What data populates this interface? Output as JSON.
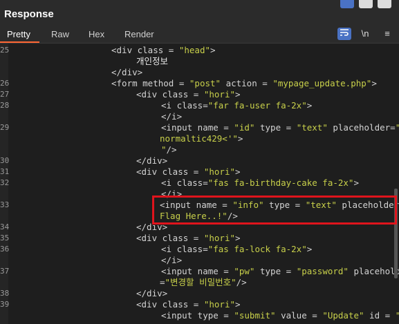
{
  "panel": {
    "title": "Response",
    "tabs": [
      "Pretty",
      "Raw",
      "Hex",
      "Render"
    ],
    "active_tab": "Pretty",
    "tools": {
      "wrap_icon": "wrap-icon",
      "newline_label": "\\n",
      "menu_icon": "hamburger-menu-icon"
    },
    "layout_buttons": [
      "split-horizontal-icon",
      "split-vertical-icon",
      "single-pane-icon"
    ]
  },
  "colors": {
    "accent": "#ff6633",
    "string": "#c8d04a",
    "highlight_border": "#e0141c",
    "active_tool": "#4a72c4"
  },
  "lines": [
    {
      "num": "25",
      "parts": [
        [
          "tag",
          "<div class = "
        ],
        [
          "str",
          "\"head\""
        ],
        [
          "tag",
          ">"
        ]
      ]
    },
    {
      "num": "",
      "parts": [
        [
          "text",
          "개인정보"
        ]
      ]
    },
    {
      "num": "",
      "parts": [
        [
          "tag",
          "</div>"
        ]
      ]
    },
    {
      "num": "26",
      "parts": [
        [
          "tag",
          "<form method = "
        ],
        [
          "str",
          "\"post\""
        ],
        [
          "tag",
          " action = "
        ],
        [
          "str",
          "\"mypage_update.php\""
        ],
        [
          "tag",
          ">"
        ]
      ]
    },
    {
      "num": "27",
      "parts": [
        [
          "tag",
          "<div class = "
        ],
        [
          "str",
          "\"hori\""
        ],
        [
          "tag",
          ">"
        ]
      ]
    },
    {
      "num": "28",
      "parts": [
        [
          "tag",
          "<i class="
        ],
        [
          "str",
          "\"far fa-user fa-2x\""
        ],
        [
          "tag",
          ">"
        ]
      ]
    },
    {
      "num": "",
      "parts": [
        [
          "tag",
          "</i>"
        ]
      ]
    },
    {
      "num": "29",
      "parts": [
        [
          "tag",
          "<input name = "
        ],
        [
          "str",
          "\"id\""
        ],
        [
          "tag",
          " type = "
        ],
        [
          "str",
          "\"text\""
        ],
        [
          "tag",
          " placeholder="
        ],
        [
          "str",
          "\""
        ]
      ]
    },
    {
      "num": "",
      "parts": [
        [
          "str",
          "normaltic429<'\""
        ],
        [
          "tag",
          ">"
        ]
      ]
    },
    {
      "num": "",
      "parts": [
        [
          "str",
          "\""
        ],
        [
          "tag",
          "/>"
        ]
      ]
    },
    {
      "num": "30",
      "parts": [
        [
          "tag",
          "</div>"
        ]
      ]
    },
    {
      "num": "31",
      "parts": [
        [
          "tag",
          "<div class = "
        ],
        [
          "str",
          "\"hori\""
        ],
        [
          "tag",
          ">"
        ]
      ]
    },
    {
      "num": "32",
      "parts": [
        [
          "tag",
          "<i class="
        ],
        [
          "str",
          "\"fas fa-birthday-cake fa-2x\""
        ],
        [
          "tag",
          ">"
        ]
      ]
    },
    {
      "num": "",
      "parts": [
        [
          "tag",
          "</i>"
        ]
      ]
    },
    {
      "num": "33",
      "parts": [
        [
          "tag",
          "<input name = "
        ],
        [
          "str",
          "\"info\""
        ],
        [
          "tag",
          " type = "
        ],
        [
          "str",
          "\"text\""
        ],
        [
          "tag",
          " placeholder="
        ],
        [
          "str",
          "\""
        ]
      ]
    },
    {
      "num": "",
      "parts": [
        [
          "str",
          "Flag Here..!\""
        ],
        [
          "tag",
          "/>"
        ]
      ]
    },
    {
      "num": "34",
      "parts": [
        [
          "tag",
          "</div>"
        ]
      ]
    },
    {
      "num": "35",
      "parts": [
        [
          "tag",
          "<div class = "
        ],
        [
          "str",
          "\"hori\""
        ],
        [
          "tag",
          ">"
        ]
      ]
    },
    {
      "num": "36",
      "parts": [
        [
          "tag",
          "<i class="
        ],
        [
          "str",
          "\"fas fa-lock fa-2x\""
        ],
        [
          "tag",
          ">"
        ]
      ]
    },
    {
      "num": "",
      "parts": [
        [
          "tag",
          "</i>"
        ]
      ]
    },
    {
      "num": "37",
      "parts": [
        [
          "tag",
          "<input name = "
        ],
        [
          "str",
          "\"pw\""
        ],
        [
          "tag",
          " type = "
        ],
        [
          "str",
          "\"password\""
        ],
        [
          "tag",
          " placeholder"
        ]
      ]
    },
    {
      "num": "",
      "parts": [
        [
          "tag",
          "="
        ],
        [
          "str",
          "\"변경할 비밀번호\""
        ],
        [
          "tag",
          "/>"
        ]
      ]
    },
    {
      "num": "38",
      "parts": [
        [
          "tag",
          "</div>"
        ]
      ]
    },
    {
      "num": "39",
      "parts": [
        [
          "tag",
          "<div class = "
        ],
        [
          "str",
          "\"hori\""
        ],
        [
          "tag",
          ">"
        ]
      ]
    },
    {
      "num": "",
      "parts": [
        [
          "tag",
          "<input type = "
        ],
        [
          "str",
          "\"submit\""
        ],
        [
          "tag",
          " value = "
        ],
        [
          "str",
          "\"Update\""
        ],
        [
          "tag",
          " id = "
        ],
        [
          "str",
          "\""
        ]
      ]
    }
  ]
}
